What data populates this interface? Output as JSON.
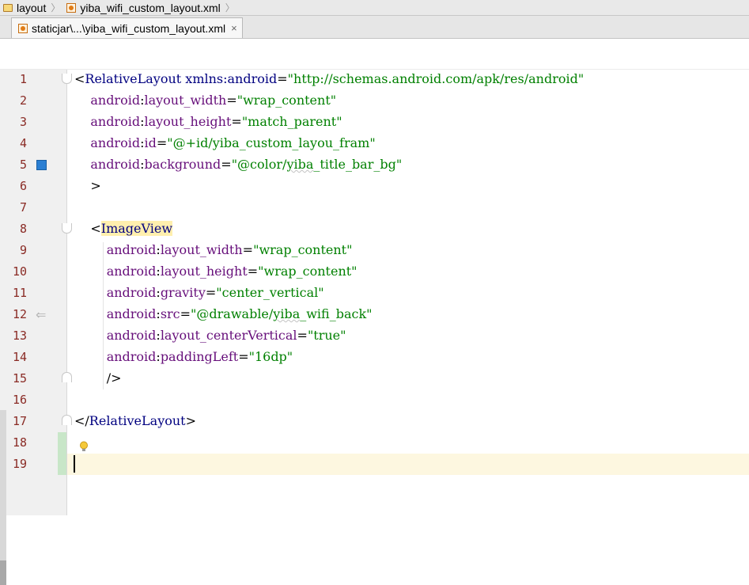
{
  "navbar": {
    "crumbs": [
      {
        "label": "layout",
        "icon": "folder-icon"
      },
      {
        "label": "yiba_wifi_custom_layout.xml",
        "icon": "xml-file-icon"
      }
    ]
  },
  "tabs": [
    {
      "label": "staticjar\\...\\yiba_wifi_custom_layout.xml",
      "close": "×",
      "active": true
    }
  ],
  "editor": {
    "current_line": 19,
    "lines": [
      {
        "num": "1"
      },
      {
        "num": "2"
      },
      {
        "num": "3"
      },
      {
        "num": "4"
      },
      {
        "num": "5"
      },
      {
        "num": "6"
      },
      {
        "num": "7"
      },
      {
        "num": "8"
      },
      {
        "num": "9"
      },
      {
        "num": "10"
      },
      {
        "num": "11"
      },
      {
        "num": "12"
      },
      {
        "num": "13"
      },
      {
        "num": "14"
      },
      {
        "num": "15"
      },
      {
        "num": "16"
      },
      {
        "num": "17"
      },
      {
        "num": "18"
      },
      {
        "num": "19"
      }
    ],
    "code": {
      "l1": {
        "open": "<",
        "tag": "RelativeLayout",
        "attr": "xmlns:android",
        "eq": "=",
        "val": "\"http://schemas.android.com/apk/res/android\""
      },
      "l2": {
        "ns": "android",
        "colon": ":",
        "attr": "layout_width",
        "eq": "=",
        "val": "\"wrap_content\""
      },
      "l3": {
        "ns": "android",
        "colon": ":",
        "attr": "layout_height",
        "eq": "=",
        "val": "\"match_parent\""
      },
      "l4": {
        "ns": "android",
        "colon": ":",
        "attr": "id",
        "eq": "=",
        "val": "\"@+id/yiba_custom_layou_fram\""
      },
      "l5": {
        "ns": "android",
        "colon": ":",
        "attr": "background",
        "eq": "=",
        "val_a": "\"@color/",
        "val_b": "yiba",
        "val_c": "_title_bar_bg\""
      },
      "l6": {
        "text": ">"
      },
      "l8": {
        "open": "<",
        "tag": "ImageView"
      },
      "l9": {
        "ns": "android",
        "colon": ":",
        "attr": "layout_width",
        "eq": "=",
        "val": "\"wrap_content\""
      },
      "l10": {
        "ns": "android",
        "colon": ":",
        "attr": "layout_height",
        "eq": "=",
        "val": "\"wrap_content\""
      },
      "l11": {
        "ns": "android",
        "colon": ":",
        "attr": "gravity",
        "eq": "=",
        "val": "\"center_vertical\""
      },
      "l12": {
        "ns": "android",
        "colon": ":",
        "attr": "src",
        "eq": "=",
        "val_a": "\"@drawable/",
        "val_b": "yiba",
        "val_c": "_wifi_back\""
      },
      "l13": {
        "ns": "android",
        "colon": ":",
        "attr": "layout_centerVertical",
        "eq": "=",
        "val": "\"true\""
      },
      "l14": {
        "ns": "android",
        "colon": ":",
        "attr": "paddingLeft",
        "eq": "=",
        "val": "\"16dp\""
      },
      "l15": {
        "text": "/>"
      },
      "l17": {
        "open": "</",
        "tag": "RelativeLayout",
        "close": ">"
      }
    }
  },
  "colors": {
    "tag": "#000080",
    "attribute": "#660e7a",
    "value": "#008000",
    "line_number": "#8a2b25",
    "current_line": "#fdf7e0",
    "change_marker": "#c8e6c8",
    "color_swatch": "#2b7fd3"
  }
}
